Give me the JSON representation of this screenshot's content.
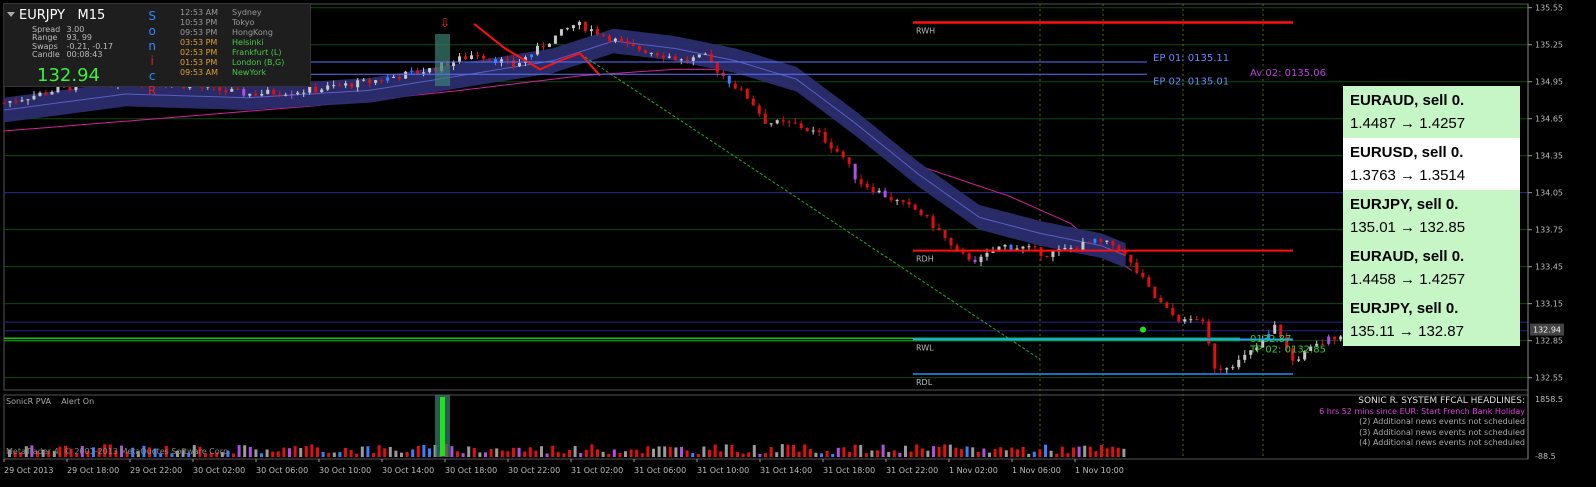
{
  "window": {
    "symbol": "EURJPY",
    "timeframe": "M15",
    "spread_label": "Spread",
    "spread": "3.00",
    "range_label": "Range",
    "range": "93, 99",
    "swaps_label": "Swaps",
    "swaps": "-0.21, -0.17",
    "candle_label": "Candle",
    "candle": "00:08:43",
    "bid": "132.94"
  },
  "sonic_letters": [
    "S",
    "o",
    "n",
    "i",
    "c",
    "R"
  ],
  "sessions": [
    {
      "time": "12:53 AM",
      "city": "Sydney",
      "color": "#9a9a9a"
    },
    {
      "time": "10:53 PM",
      "city": "Tokyo",
      "color": "#9a9a9a"
    },
    {
      "time": "09:53 PM",
      "city": "HongKong",
      "color": "#9a9a9a"
    },
    {
      "time": "03:53 PM",
      "city": "Helsinki",
      "color": "#44cc44"
    },
    {
      "time": "02:53 PM",
      "city": "Frankfurt  (L)",
      "color": "#44cc44"
    },
    {
      "time": "01:53 PM",
      "city": "London  (B,G)",
      "color": "#44cc44"
    },
    {
      "time": "09:53 AM",
      "city": "NewYork",
      "color": "#44cc44"
    }
  ],
  "levels": {
    "rwh": "RWH",
    "rdh": "RDH",
    "rwl": "RWL",
    "rdl": "RDL",
    "ep01": "EP 01: 0135.11",
    "ep02": "EP 02: 0135.01",
    "av02": "Av 02:  0135.06",
    "tp01": "0132.87",
    "tp02": "TP 02:  0132.85"
  },
  "signals": [
    {
      "head": "EURAUD, sell 0.",
      "val": "1.4487 → 1.4257",
      "bg": "#c6f5c6"
    },
    {
      "head": "EURUSD, sell 0.",
      "val": "1.3763 → 1.3514",
      "bg": "#ffffff"
    },
    {
      "head": "EURJPY, sell 0.",
      "val": "135.01 → 132.85",
      "bg": "#c6f5c6"
    },
    {
      "head": "EURAUD, sell 0.",
      "val": "1.4458 → 1.4257",
      "bg": "#c6f5c6"
    },
    {
      "head": "EURJPY, sell 0.",
      "val": "135.11 → 132.87",
      "bg": "#c6f5c6"
    }
  ],
  "indicator": {
    "name": "SonicR PVA",
    "alert": "Alert On",
    "copyright": "MetaTrader 4, © 2001-2013 MetaQuotes Software Corp.",
    "scale_top": "1858.5",
    "scale_bottom": "-88.5"
  },
  "news": {
    "headline": "SONIC R. SYSTEM  FFCAL HEADLINES:",
    "main": "6 hrs 52 mins since EUR: Start French Bank Holiday",
    "items": [
      "(2)  Additional news events not scheduled",
      "(3)  Additional news events not scheduled",
      "(4)  Additional news events not scheduled"
    ]
  },
  "colors": {
    "background": "#000000",
    "bull": "#c8c8c8",
    "bear": "#e01010",
    "band": "#2a2d6e",
    "slow_ma": "#d0209a",
    "res": "#ff1010",
    "sup": "#1e90ff"
  },
  "chart_data": {
    "type": "candlestick",
    "symbol": "EURJPY",
    "timeframe": "M15",
    "ylim": [
      132.45,
      135.58
    ],
    "y_ticks": [
      135.55,
      135.25,
      134.95,
      134.65,
      134.35,
      134.05,
      133.75,
      133.45,
      133.15,
      132.85,
      132.55
    ],
    "x_ticks": [
      "29 Oct 2013",
      "29 Oct 18:00",
      "29 Oct 22:00",
      "30 Oct 02:00",
      "30 Oct 06:00",
      "30 Oct 10:00",
      "30 Oct 14:00",
      "30 Oct 18:00",
      "30 Oct 22:00",
      "31 Oct 02:00",
      "31 Oct 06:00",
      "31 Oct 10:00",
      "31 Oct 14:00",
      "31 Oct 18:00",
      "31 Oct 22:00",
      "1 Nov 02:00",
      "1 Nov 06:00",
      "1 Nov 10:00"
    ],
    "current_price": 132.94,
    "close_path": [
      [
        0,
        134.78
      ],
      [
        0.04,
        134.9
      ],
      [
        0.08,
        134.97
      ],
      [
        0.12,
        134.92
      ],
      [
        0.16,
        134.85
      ],
      [
        0.2,
        134.88
      ],
      [
        0.24,
        134.95
      ],
      [
        0.28,
        135.05
      ],
      [
        0.31,
        135.18
      ],
      [
        0.335,
        135.08
      ],
      [
        0.36,
        135.3
      ],
      [
        0.375,
        135.42
      ],
      [
        0.39,
        135.35
      ],
      [
        0.41,
        135.23
      ],
      [
        0.43,
        135.18
      ],
      [
        0.445,
        135.12
      ],
      [
        0.46,
        135.15
      ],
      [
        0.47,
        135.02
      ],
      [
        0.49,
        134.8
      ],
      [
        0.5,
        134.62
      ],
      [
        0.52,
        134.6
      ],
      [
        0.535,
        134.52
      ],
      [
        0.55,
        134.35
      ],
      [
        0.56,
        134.15
      ],
      [
        0.575,
        134.05
      ],
      [
        0.59,
        133.95
      ],
      [
        0.6,
        133.9
      ],
      [
        0.615,
        133.72
      ],
      [
        0.625,
        133.55
      ],
      [
        0.64,
        133.5
      ],
      [
        0.655,
        133.62
      ],
      [
        0.67,
        133.6
      ],
      [
        0.685,
        133.55
      ],
      [
        0.7,
        133.6
      ],
      [
        0.715,
        133.65
      ],
      [
        0.73,
        133.62
      ],
      [
        0.745,
        133.38
      ],
      [
        0.755,
        133.2
      ],
      [
        0.765,
        133.07
      ],
      [
        0.775,
        133.0
      ],
      [
        0.785,
        133.05
      ],
      [
        0.795,
        132.62
      ],
      [
        0.81,
        132.68
      ],
      [
        0.825,
        132.82
      ],
      [
        0.835,
        132.98
      ],
      [
        0.845,
        132.68
      ],
      [
        0.86,
        132.8
      ],
      [
        0.875,
        132.9
      ],
      [
        0.9,
        132.92
      ],
      [
        0.925,
        132.93
      ],
      [
        0.94,
        132.94
      ]
    ],
    "fast_ma_path": [
      [
        0,
        134.72
      ],
      [
        0.08,
        134.85
      ],
      [
        0.16,
        134.82
      ],
      [
        0.24,
        134.88
      ],
      [
        0.3,
        135.0
      ],
      [
        0.36,
        135.12
      ],
      [
        0.4,
        135.28
      ],
      [
        0.44,
        135.22
      ],
      [
        0.48,
        135.12
      ],
      [
        0.52,
        134.97
      ],
      [
        0.56,
        134.6
      ],
      [
        0.6,
        134.2
      ],
      [
        0.64,
        133.85
      ],
      [
        0.68,
        133.72
      ],
      [
        0.72,
        133.62
      ],
      [
        0.76,
        133.42
      ],
      [
        0.8,
        133.12
      ],
      [
        0.84,
        132.98
      ],
      [
        0.88,
        132.98
      ],
      [
        0.92,
        132.97
      ],
      [
        0.94,
        132.96
      ]
    ],
    "slow_ma_path": [
      [
        0,
        134.55
      ],
      [
        0.1,
        134.65
      ],
      [
        0.2,
        134.75
      ],
      [
        0.3,
        134.88
      ],
      [
        0.38,
        135.0
      ],
      [
        0.44,
        135.05
      ],
      [
        0.48,
        135.05
      ],
      [
        0.52,
        134.9
      ],
      [
        0.56,
        134.55
      ],
      [
        0.6,
        134.27
      ],
      [
        0.66,
        134.02
      ],
      [
        0.7,
        133.8
      ],
      [
        0.72,
        133.58
      ],
      [
        0.74,
        133.42
      ],
      [
        0.76,
        133.3
      ],
      [
        0.78,
        133.23
      ],
      [
        0.8,
        133.2
      ],
      [
        0.82,
        133.22
      ]
    ],
    "levels": {
      "rwh": 135.43,
      "rdh": 133.58,
      "rwl": 132.86,
      "rdl": 132.58,
      "ep01": 135.11,
      "ep02": 135.01,
      "av02": 135.06,
      "tp01": 132.87,
      "tp02": 132.85
    },
    "volume_scale": [
      -88.5,
      1858.5
    ]
  }
}
